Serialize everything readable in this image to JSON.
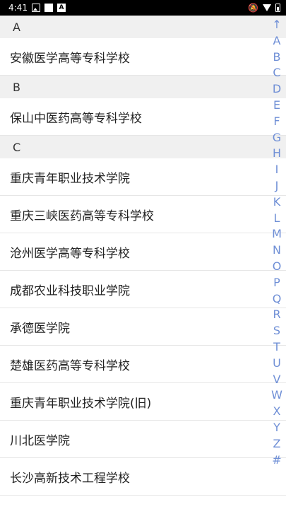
{
  "status_bar": {
    "time": "4:41",
    "left_icons": [
      "image-icon",
      "square-icon",
      "a-icon"
    ],
    "right_icons": [
      "bell-off-icon",
      "wifi-icon",
      "battery-icon"
    ]
  },
  "sections": [
    {
      "header": "A",
      "items": [
        "安徽医学高等专科学校"
      ]
    },
    {
      "header": "B",
      "items": [
        "保山中医药高等专科学校"
      ]
    },
    {
      "header": "C",
      "items": [
        "重庆青年职业技术学院",
        "重庆三峡医药高等专科学校",
        "沧州医学高等专科学校",
        "成都农业科技职业学院",
        "承德医学院",
        "楚雄医药高等专科学校",
        "重庆青年职业技术学院(旧)",
        "川北医学院",
        "长沙高新技术工程学校"
      ]
    }
  ],
  "index_bar": [
    "↑",
    "A",
    "B",
    "C",
    "D",
    "E",
    "F",
    "G",
    "H",
    "I",
    "J",
    "K",
    "L",
    "M",
    "N",
    "O",
    "P",
    "Q",
    "R",
    "S",
    "T",
    "U",
    "V",
    "W",
    "X",
    "Y",
    "Z",
    "#"
  ],
  "colors": {
    "index": "#6f8fd6",
    "header_bg": "#f0f0f0",
    "status_bg": "#000000"
  }
}
